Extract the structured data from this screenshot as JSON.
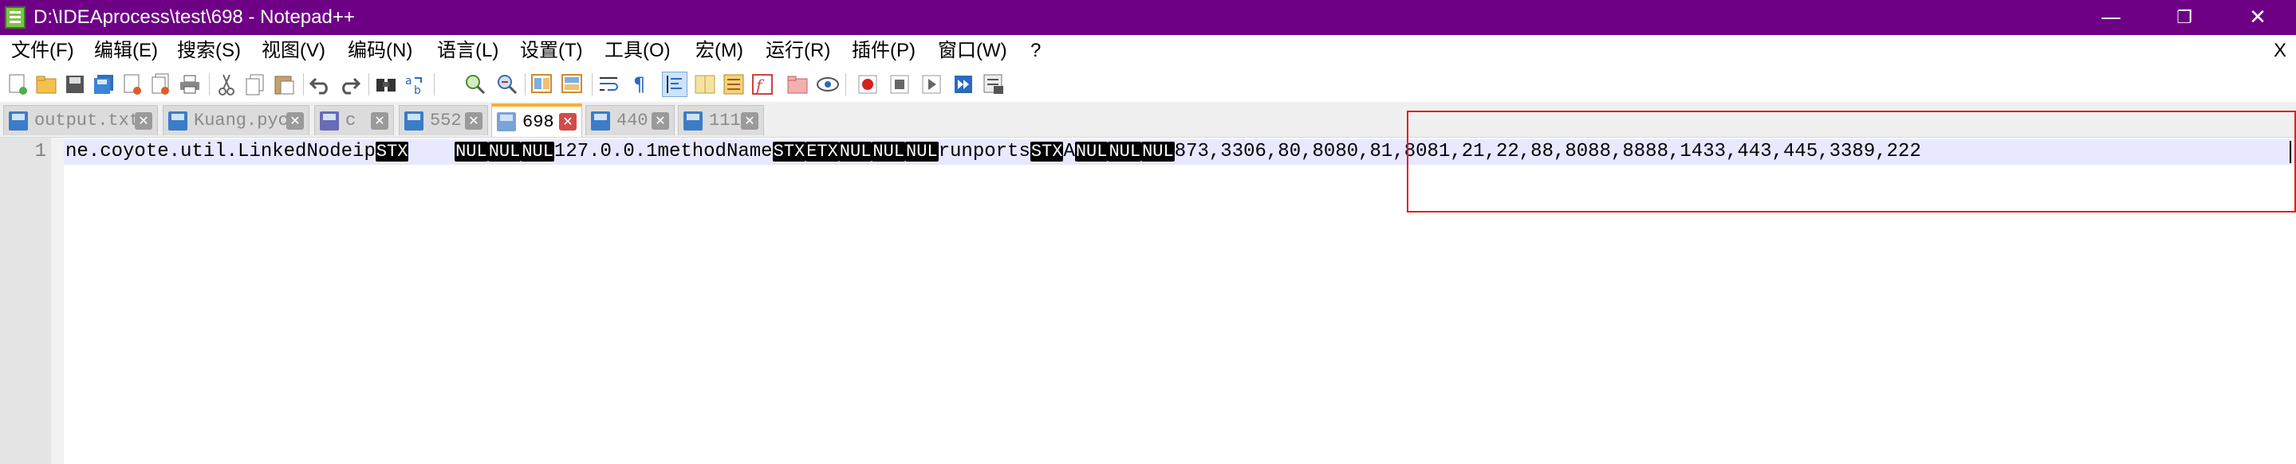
{
  "window": {
    "title": "D:\\IDEAprocess\\test\\698 - Notepad++",
    "minimize": "—",
    "maximize": "❐",
    "close": "✕"
  },
  "menu": {
    "items": [
      "文件(F)",
      "编辑(E)",
      "搜索(S)",
      "视图(V)",
      "编码(N)",
      "语言(L)",
      "设置(T)",
      "工具(O)",
      "宏(M)",
      "运行(R)",
      "插件(P)",
      "窗口(W)",
      "?"
    ],
    "close": "X"
  },
  "toolbar": {
    "icons": [
      "new-file-icon",
      "open-file-icon",
      "save-icon",
      "save-all-icon",
      "close-icon",
      "close-all-icon",
      "print-icon",
      "cut-icon",
      "copy-icon",
      "paste-icon",
      "undo-icon",
      "redo-icon",
      "find-icon",
      "replace-icon",
      "zoom-in-icon",
      "zoom-out-icon",
      "sync-vertical-icon",
      "sync-horizontal-icon",
      "word-wrap-icon",
      "show-all-chars-icon",
      "indent-guide-icon",
      "doc-map-icon",
      "function-list-icon",
      "folder-workspace-icon",
      "monitor-icon",
      "record-macro-icon",
      "stop-record-icon",
      "play-macro-icon",
      "run-macro-multiple-icon",
      "save-macro-icon"
    ]
  },
  "tabs": [
    {
      "label": "output.txt",
      "active": false
    },
    {
      "label": "Kuang.pyc",
      "active": false
    },
    {
      "label": "c",
      "active": false
    },
    {
      "label": "552",
      "active": false
    },
    {
      "label": "698",
      "active": true
    },
    {
      "label": "440",
      "active": false
    },
    {
      "label": "111",
      "active": false
    }
  ],
  "editor": {
    "line_number": "1",
    "segments": {
      "s1": "ne.coyote.util.LinkedNodeip",
      "c1": "STX",
      "s2": "    ",
      "c2": "NUL",
      "c3": "NUL",
      "c4": "NUL",
      "s3": "127.0.0.1methodName",
      "c5": "STX",
      "c6": "ETX",
      "c7": "NUL",
      "c8": "NUL",
      "c9": "NUL",
      "s4": "runports",
      "c10": "STX",
      "s5": "A",
      "c11": "NUL",
      "c12": "NUL",
      "c13": "NUL",
      "s6": "873,3306,80,8080,81,8081,21,22,88,8088,8888,1433,443,445,3389,222"
    }
  },
  "colors": {
    "titlebar": "#6e0086",
    "active_tab_accent": "#fab02a",
    "highlight_box": "#e02020",
    "current_line": "#e8e8ff"
  }
}
